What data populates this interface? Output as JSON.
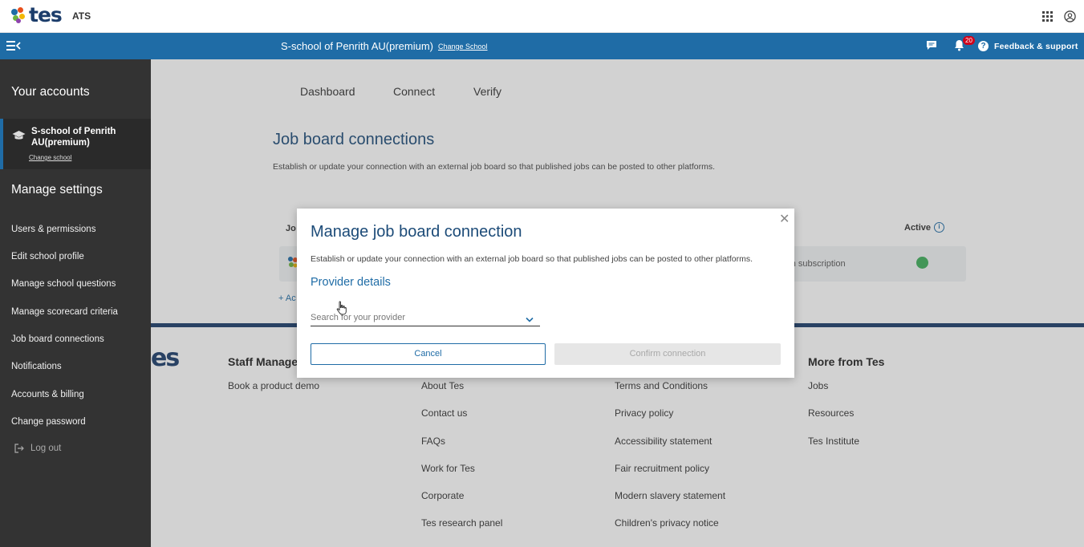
{
  "app": {
    "logo_text": "tes",
    "product": "ATS"
  },
  "header": {
    "school_title": "S-school of Penrith AU(premium)",
    "change_school": "Change School",
    "notification_count": "20",
    "feedback": "Feedback & support",
    "accent_color": "#1f6ca6"
  },
  "sidebar": {
    "accounts_heading": "Your accounts",
    "account_name": "S-school of Penrith AU(premium)",
    "account_change": "Change school",
    "settings_heading": "Manage settings",
    "items": [
      "Users & permissions",
      "Edit school profile",
      "Manage school questions",
      "Manage scorecard criteria",
      "Job board connections",
      "Notifications",
      "Accounts & billing",
      "Change password"
    ],
    "logout": "Log out"
  },
  "tabs": [
    "Dashboard",
    "Connect",
    "Verify"
  ],
  "page": {
    "title": "Job board connections",
    "description": "Establish or update your connection with an external job board so that published jobs can be posted to other platforms.",
    "table_head_partial": "Jo",
    "active_label": "Active",
    "row_subscription_text": "ed in subscription",
    "add_partial": "+ Ac"
  },
  "footer": {
    "logo_partial": "es",
    "columns": [
      {
        "heading": "Staff Manage",
        "links": [
          "Book a product demo"
        ]
      },
      {
        "heading": "",
        "links": [
          "About Tes",
          "Contact us",
          "FAQs",
          "Work for Tes",
          "Corporate",
          "Tes research panel"
        ]
      },
      {
        "heading": "",
        "links": [
          "Terms and Conditions",
          "Privacy policy",
          "Accessibility statement",
          "Fair recruitment policy",
          "Modern slavery statement",
          "Children's privacy notice"
        ]
      },
      {
        "heading": "More from Tes",
        "links": [
          "Jobs",
          "Resources",
          "Tes Institute"
        ]
      }
    ]
  },
  "modal": {
    "title": "Manage job board connection",
    "description": "Establish or update your connection with an external job board so that published jobs can be posted to other platforms.",
    "section": "Provider details",
    "select_placeholder": "Search for your provider",
    "cancel_label": "Cancel",
    "confirm_label": "Confirm connection",
    "close_glyph": "✕"
  }
}
